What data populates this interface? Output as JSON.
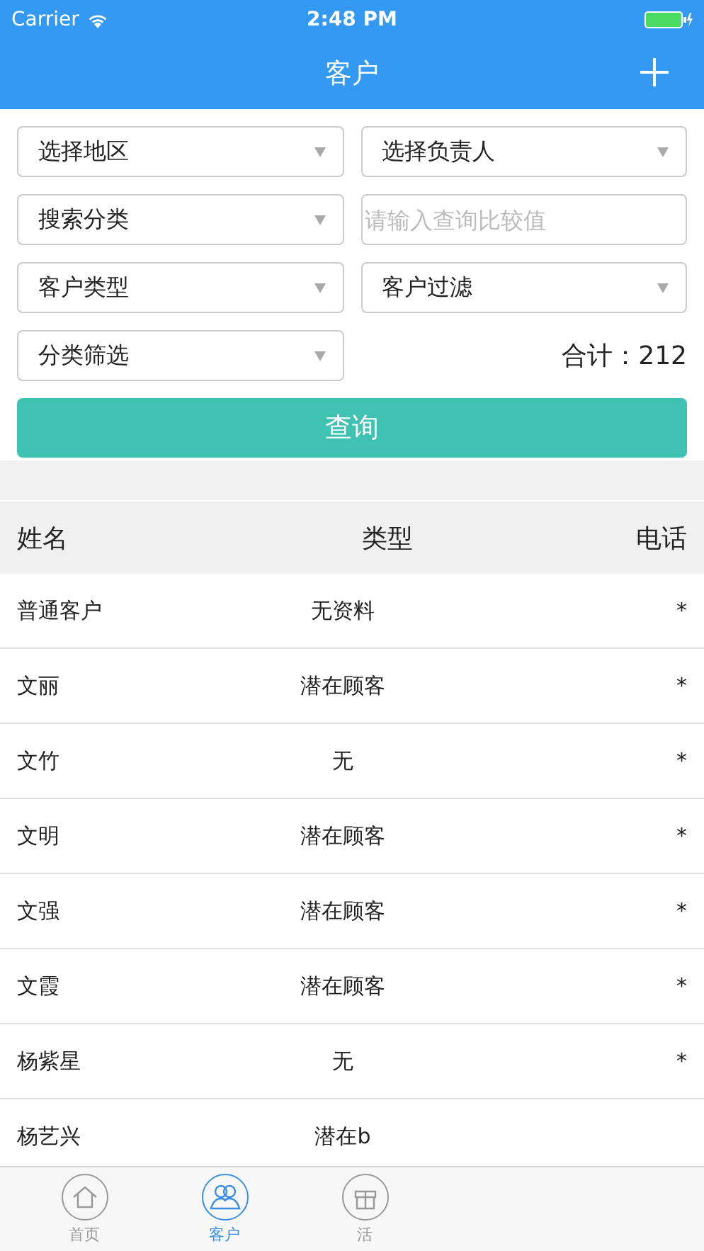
{
  "status_bar": {
    "carrier": "Carrier",
    "time": "2:48 PM"
  },
  "nav": {
    "title": "客户"
  },
  "filters": [
    {
      "kind": "select",
      "label": "选择地区"
    },
    {
      "kind": "select",
      "label": "选择负责人"
    },
    {
      "kind": "select",
      "label": "搜索分类"
    },
    {
      "kind": "input",
      "placeholder": "请输入查询比较值"
    },
    {
      "kind": "select",
      "label": "客户类型"
    },
    {
      "kind": "select",
      "label": "客户过滤"
    },
    {
      "kind": "select",
      "label": "分类筛选"
    }
  ],
  "total": "合计：212",
  "query_button": "查询",
  "table": {
    "columns": [
      "姓名",
      "类型",
      "电话"
    ],
    "rows": [
      [
        "普通客户",
        "无资料",
        "*"
      ],
      [
        "文丽",
        "潜在顾客",
        "*"
      ],
      [
        "文竹",
        "无",
        "*"
      ],
      [
        "文明",
        "潜在顾客",
        "*"
      ],
      [
        "文强",
        "潜在顾客",
        "*"
      ],
      [
        "文霞",
        "潜在顾客",
        "*"
      ],
      [
        "杨紫星",
        "无",
        "*"
      ],
      [
        "杨艺兴",
        "潜在b",
        ""
      ]
    ]
  },
  "tabs": [
    {
      "label": "首页",
      "kind": "home",
      "selected": false
    },
    {
      "label": "客户",
      "kind": "people",
      "selected": true
    },
    {
      "label": "活",
      "kind": "gift",
      "selected": false
    }
  ]
}
